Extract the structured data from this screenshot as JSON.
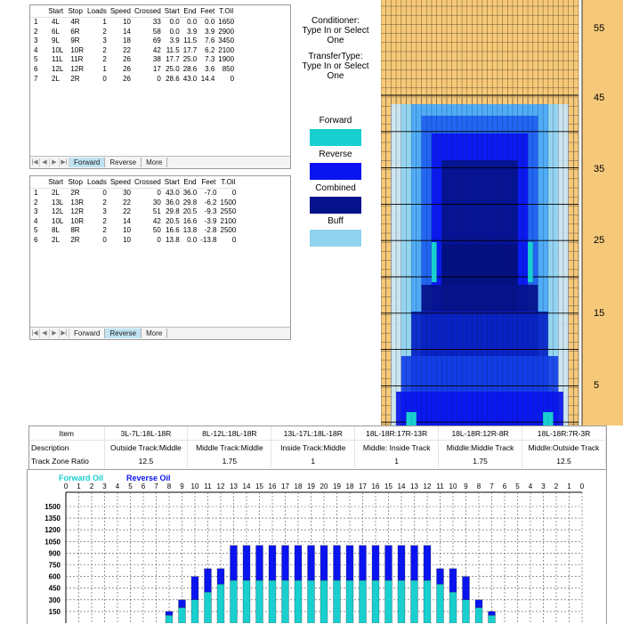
{
  "forward_grid": {
    "headers": [
      "Start",
      "Stop",
      "Loads",
      "Speed",
      "Crossed",
      "Start",
      "End",
      "Feet",
      "T.Oil"
    ],
    "rows": [
      [
        "1",
        "4L",
        "4R",
        "1",
        "10",
        "33",
        "0.0",
        "0.0",
        "0.0",
        "1650"
      ],
      [
        "2",
        "6L",
        "6R",
        "2",
        "14",
        "58",
        "0.0",
        "3.9",
        "3.9",
        "2900"
      ],
      [
        "3",
        "9L",
        "9R",
        "3",
        "18",
        "69",
        "3.9",
        "11.5",
        "7.6",
        "3450"
      ],
      [
        "4",
        "10L",
        "10R",
        "2",
        "22",
        "42",
        "11.5",
        "17.7",
        "6.2",
        "2100"
      ],
      [
        "5",
        "11L",
        "11R",
        "2",
        "26",
        "38",
        "17.7",
        "25.0",
        "7.3",
        "1900"
      ],
      [
        "6",
        "12L",
        "12R",
        "1",
        "26",
        "17",
        "25.0",
        "28.6",
        "3.6",
        "850"
      ],
      [
        "7",
        "2L",
        "2R",
        "0",
        "26",
        "0",
        "28.6",
        "43.0",
        "14.4",
        "0"
      ]
    ],
    "tabs": [
      "Forward",
      "Reverse",
      "More"
    ],
    "active_tab": "Forward"
  },
  "reverse_grid": {
    "headers": [
      "Start",
      "Stop",
      "Loads",
      "Speed",
      "Crossed",
      "Start",
      "End",
      "Feet",
      "T.Oil"
    ],
    "rows": [
      [
        "1",
        "2L",
        "2R",
        "0",
        "30",
        "0",
        "43.0",
        "36.0",
        "-7.0",
        "0"
      ],
      [
        "2",
        "13L",
        "13R",
        "2",
        "22",
        "30",
        "36.0",
        "29.8",
        "-6.2",
        "1500"
      ],
      [
        "3",
        "12L",
        "12R",
        "3",
        "22",
        "51",
        "29.8",
        "20.5",
        "-9.3",
        "2550"
      ],
      [
        "4",
        "10L",
        "10R",
        "2",
        "14",
        "42",
        "20.5",
        "16.6",
        "-3.9",
        "2100"
      ],
      [
        "5",
        "8L",
        "8R",
        "2",
        "10",
        "50",
        "16.6",
        "13.8",
        "-2.8",
        "2500"
      ],
      [
        "6",
        "2L",
        "2R",
        "0",
        "10",
        "0",
        "13.8",
        "0.0",
        "-13.8",
        "0"
      ]
    ],
    "tabs": [
      "Forward",
      "Reverse",
      "More"
    ],
    "active_tab": "Reverse"
  },
  "conditioner": {
    "label": "Conditioner:",
    "hint": "Type In or Select One"
  },
  "transfer": {
    "label": "TransferType:",
    "hint": "Type In or Select One"
  },
  "legend": [
    {
      "label": "Forward",
      "color": "#19cfcf"
    },
    {
      "label": "Reverse",
      "color": "#0a14f0"
    },
    {
      "label": "Combined",
      "color": "#06128c"
    },
    {
      "label": "Buff",
      "color": "#8fd3ef"
    }
  ],
  "lane_scale": [
    "55",
    "45",
    "35",
    "25",
    "15",
    "5"
  ],
  "comparison": {
    "item_label": "Item",
    "columns": [
      "3L-7L:18L-18R",
      "8L-12L:18L-18R",
      "13L-17L:18L-18R",
      "18L-18R:17R-13R",
      "18L-18R:12R-8R",
      "18L-18R:7R-3R"
    ],
    "rows": [
      {
        "label": "Description",
        "values": [
          "Outside Track:Middle",
          "Middle Track:Middle",
          "Inside Track:Middle",
          "Middle: Inside Track",
          "Middle:Middle Track",
          "Middle:Outside Track"
        ]
      },
      {
        "label": "Track Zone Ratio",
        "values": [
          "12.5",
          "1.75",
          "1",
          "1",
          "1.75",
          "12.5"
        ]
      }
    ]
  },
  "chart_data": {
    "type": "bar",
    "legend": [
      "Forward Oil",
      "Reverse Oil"
    ],
    "legend_colors": [
      "#19cfcf",
      "#0a14f0"
    ],
    "categories": [
      "0",
      "1",
      "2",
      "3",
      "4",
      "5",
      "6",
      "7",
      "8",
      "9",
      "10",
      "11",
      "12",
      "13",
      "14",
      "15",
      "16",
      "17",
      "18",
      "19",
      "20",
      "19",
      "18",
      "17",
      "16",
      "15",
      "14",
      "13",
      "12",
      "11",
      "10",
      "9",
      "8",
      "7",
      "6",
      "5",
      "4",
      "3",
      "2",
      "1",
      "0"
    ],
    "series": [
      {
        "name": "Forward Oil",
        "values": [
          0,
          0,
          0,
          0,
          0,
          0,
          0,
          0,
          100,
          200,
          300,
          400,
          500,
          550,
          550,
          550,
          550,
          550,
          550,
          550,
          550,
          550,
          550,
          550,
          550,
          550,
          550,
          550,
          550,
          500,
          400,
          300,
          200,
          100,
          0,
          0,
          0,
          0,
          0,
          0,
          0
        ]
      },
      {
        "name": "Reverse Oil",
        "values": [
          0,
          0,
          0,
          0,
          0,
          0,
          0,
          0,
          50,
          100,
          300,
          300,
          200,
          450,
          450,
          450,
          450,
          450,
          450,
          450,
          450,
          450,
          450,
          450,
          450,
          450,
          450,
          450,
          450,
          200,
          300,
          300,
          100,
          50,
          0,
          0,
          0,
          0,
          0,
          0,
          0
        ]
      }
    ],
    "yticks": [
      "1500",
      "1350",
      "1200",
      "1050",
      "900",
      "750",
      "600",
      "450",
      "300",
      "150"
    ],
    "ylim": [
      0,
      1550
    ],
    "stacked": true,
    "grid": true
  }
}
